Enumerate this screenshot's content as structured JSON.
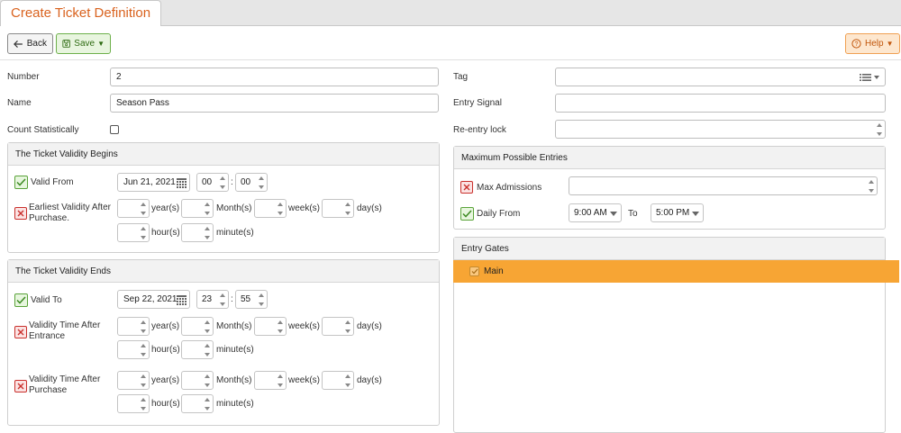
{
  "tab": {
    "title": "Create Ticket Definition"
  },
  "toolbar": {
    "back_label": "Back",
    "save_label": "Save",
    "help_label": "Help"
  },
  "form": {
    "number_label": "Number",
    "number_value": "2",
    "name_label": "Name",
    "name_value": "Season Pass",
    "count_label": "Count Statistically",
    "tag_label": "Tag",
    "entry_signal_label": "Entry Signal",
    "reentry_label": "Re-entry lock"
  },
  "validity_begins": {
    "title": "The Ticket Validity Begins",
    "valid_from_label": "Valid From",
    "date": "Jun 21, 2021",
    "hour": "00",
    "minute": "00",
    "earliest_label": "Earliest Validity After Purchase."
  },
  "validity_ends": {
    "title": "The Ticket Validity Ends",
    "valid_to_label": "Valid To",
    "date": "Sep 22, 2021",
    "hour": "23",
    "minute": "55",
    "after_entrance_label": "Validity Time After Entrance",
    "after_purchase_label": "Validity Time After Purchase"
  },
  "units": {
    "years": "year(s)",
    "months": "Month(s)",
    "weeks": "week(s)",
    "days": "day(s)",
    "hours": "hour(s)",
    "minutes": "minute(s)"
  },
  "time_sep": ":",
  "max_entries": {
    "title": "Maximum Possible Entries",
    "max_admissions_label": "Max Admissions",
    "daily_from_label": "Daily From",
    "from_value": "9:00 AM",
    "to_label": "To",
    "to_value": "5:00 PM"
  },
  "entry_gates": {
    "title": "Entry Gates",
    "items": [
      {
        "label": "Main"
      }
    ]
  },
  "colors": {
    "accent": "#d9621e",
    "selected_row": "#f7a534",
    "ok": "#5aa33a",
    "error": "#c9302c"
  }
}
